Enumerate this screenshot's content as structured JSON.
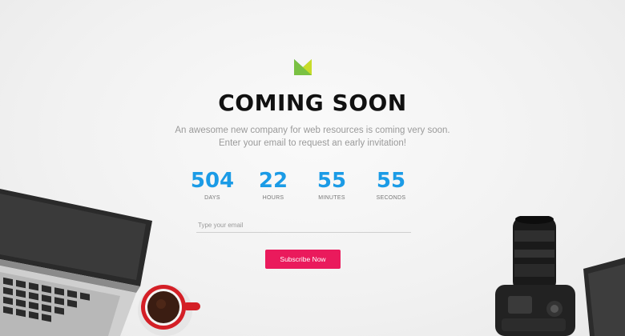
{
  "header": {
    "title": "COMING SOON",
    "subtitle_line1": "An awesome new company for web resources is coming very soon.",
    "subtitle_line2": "Enter your email to request an early invitation!"
  },
  "countdown": [
    {
      "value": "504",
      "label": "DAYS"
    },
    {
      "value": "22",
      "label": "HOURS"
    },
    {
      "value": "55",
      "label": "MINUTES"
    },
    {
      "value": "55",
      "label": "SECONDS"
    }
  ],
  "form": {
    "email_placeholder": "Type your email",
    "subscribe_label": "Subscribe Now"
  },
  "colors": {
    "accent_blue": "#1b9be6",
    "button_pink": "#ea1a5c",
    "logo_green": "#7ac143",
    "logo_dark_green": "#2e8b3a"
  }
}
